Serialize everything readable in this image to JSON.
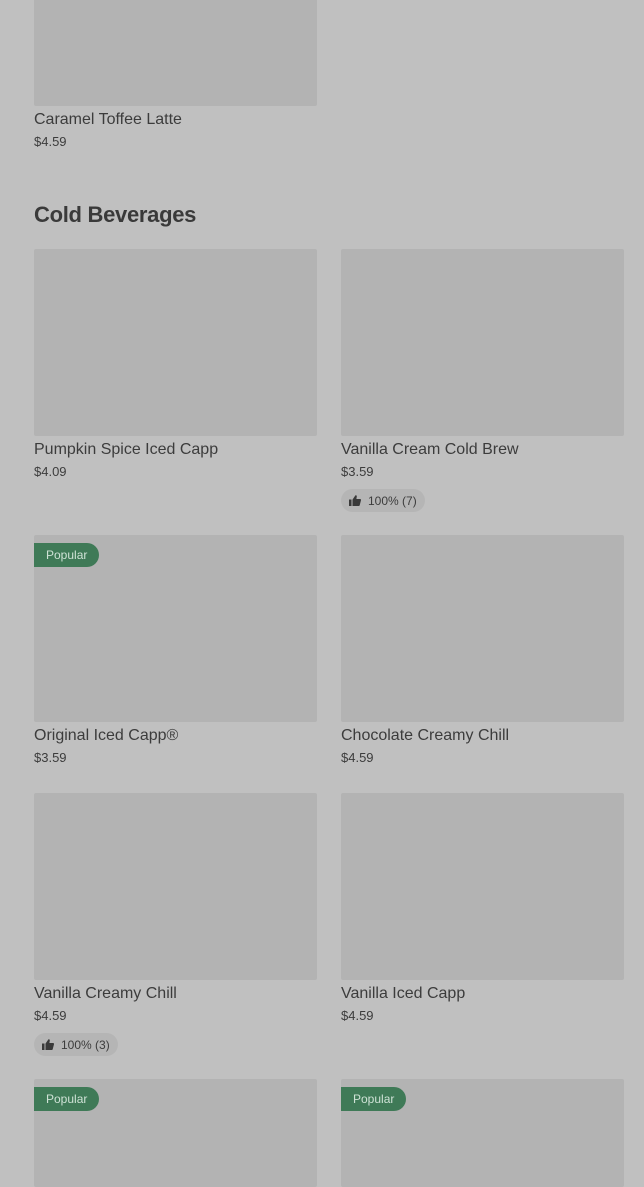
{
  "top_item": {
    "name": "Caramel Toffee Latte",
    "price": "$4.59"
  },
  "section": {
    "title": "Cold Beverages"
  },
  "items": [
    {
      "name": "Pumpkin Spice Iced Capp",
      "price": "$4.09"
    },
    {
      "name": "Vanilla Cream Cold Brew",
      "price": "$3.59",
      "rating": "100% (7)"
    },
    {
      "name": "Original Iced Capp®",
      "price": "$3.59",
      "badge": "Popular"
    },
    {
      "name": "Chocolate Creamy Chill",
      "price": "$4.59"
    },
    {
      "name": "Vanilla Creamy Chill",
      "price": "$4.59",
      "rating": "100% (3)"
    },
    {
      "name": "Vanilla Iced Capp",
      "price": "$4.59"
    },
    {
      "badge": "Popular"
    },
    {
      "badge": "Popular"
    }
  ],
  "colors": {
    "background": "#c0c0c0",
    "image_placeholder": "#b3b3b3",
    "badge_bg": "#3f7a57",
    "badge_text": "#cfe2d6"
  },
  "icons": {
    "rating": "thumbs-up-icon"
  }
}
